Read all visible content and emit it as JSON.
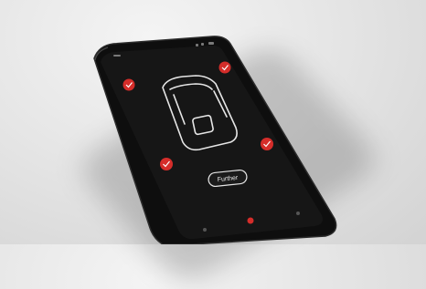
{
  "app": {
    "button_label": "Further"
  },
  "icons": {
    "check": "check-icon",
    "car": "car-outline-icon",
    "home": "home-nav-icon"
  },
  "colors": {
    "accent": "#d52d2a",
    "screen": "#161616",
    "outline": "#e6e6e6"
  }
}
